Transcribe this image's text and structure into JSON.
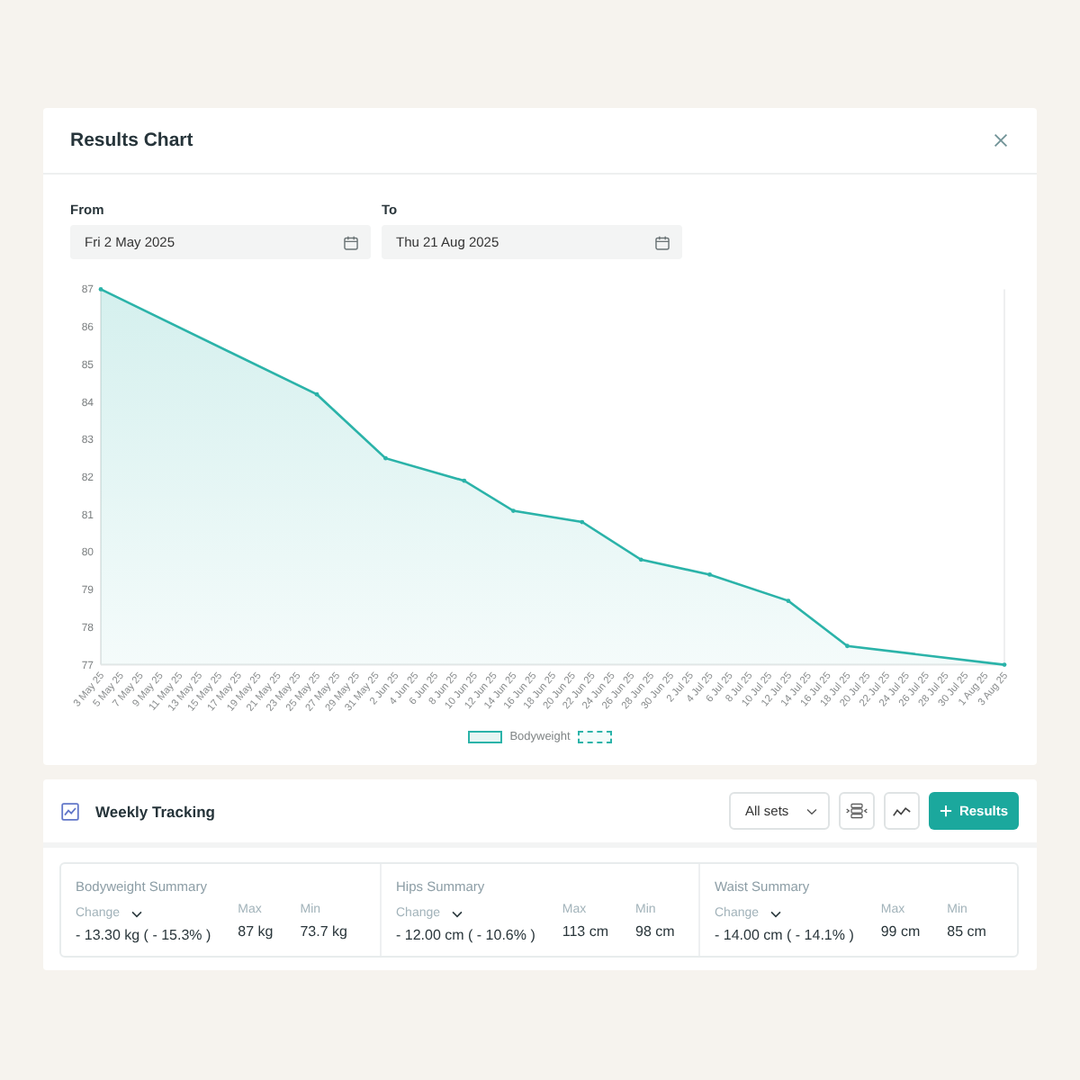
{
  "dialog": {
    "title": "Results Chart"
  },
  "date_range": {
    "from": {
      "label": "From",
      "value": "Fri 2 May 2025"
    },
    "to": {
      "label": "To",
      "value": "Thu 21 Aug 2025"
    }
  },
  "chart_data": {
    "type": "area",
    "ylim": [
      77,
      87
    ],
    "yticks": [
      77,
      78,
      79,
      80,
      81,
      82,
      83,
      84,
      85,
      86,
      87
    ],
    "categories": [
      "3 May 25",
      null,
      "5 May 25",
      null,
      "7 May 25",
      null,
      "9 May 25",
      null,
      "11 May 25",
      null,
      "13 May 25",
      null,
      "15 May 25",
      null,
      "17 May 25",
      null,
      "19 May 25",
      null,
      "21 May 25",
      null,
      "23 May 25",
      null,
      "25 May 25",
      null,
      "27 May 25",
      null,
      "29 May 25",
      null,
      "31 May 25",
      null,
      "2 Jun 25",
      null,
      "4 Jun 25",
      null,
      "6 Jun 25",
      null,
      "8 Jun 25",
      null,
      "10 Jun 25",
      null,
      "12 Jun 25",
      null,
      "14 Jun 25",
      null,
      "16 Jun 25",
      null,
      "18 Jun 25",
      null,
      "20 Jun 25",
      null,
      "22 Jun 25",
      null,
      "24 Jun 25",
      null,
      "26 Jun 25",
      null,
      "28 Jun 25",
      null,
      "30 Jun 25",
      null,
      "2 Jul 25",
      null,
      "4 Jul 25",
      null,
      "6 Jul 25",
      null,
      "8 Jul 25",
      null,
      "10 Jul 25",
      null,
      "12 Jul 25",
      null,
      "14 Jul 25",
      null,
      "16 Jul 25",
      null,
      "18 Jul 25",
      null,
      "20 Jul 25",
      null,
      "22 Jul 25",
      null,
      "24 Jul 25",
      null,
      "26 Jul 25",
      null,
      "28 Jul 25",
      null,
      "30 Jul 25",
      null,
      "1 Aug 25",
      null,
      "3 Aug 25"
    ],
    "series": [
      {
        "name": "Bodyweight",
        "color": "#2bb3a9",
        "values": [
          87,
          null,
          null,
          null,
          null,
          null,
          null,
          null,
          null,
          null,
          null,
          null,
          null,
          null,
          null,
          null,
          null,
          null,
          null,
          null,
          null,
          null,
          84.2,
          null,
          null,
          null,
          null,
          null,
          null,
          82.5,
          null,
          null,
          null,
          null,
          null,
          null,
          null,
          81.9,
          null,
          null,
          null,
          null,
          81.1,
          null,
          null,
          null,
          null,
          null,
          null,
          80.8,
          null,
          null,
          null,
          null,
          null,
          79.8,
          null,
          null,
          null,
          null,
          null,
          null,
          79.4,
          null,
          null,
          null,
          null,
          null,
          null,
          null,
          78.7,
          null,
          null,
          null,
          null,
          null,
          77.5,
          null,
          null,
          null,
          null,
          null,
          null,
          null,
          null,
          null,
          null,
          null,
          null,
          null,
          null,
          null,
          77
        ]
      }
    ]
  },
  "weekly_tracking": {
    "title": "Weekly Tracking",
    "set_filter": "All sets",
    "add_button": "Results",
    "summaries": [
      {
        "title": "Bodyweight Summary",
        "change_label": "Change",
        "change": "- 13.30 kg ( - 15.3% )",
        "max_label": "Max",
        "max": "87 kg",
        "min_label": "Min",
        "min": "73.7 kg"
      },
      {
        "title": "Hips Summary",
        "change_label": "Change",
        "change": "- 12.00 cm ( - 10.6% )",
        "max_label": "Max",
        "max": "113 cm",
        "min_label": "Min",
        "min": "98 cm"
      },
      {
        "title": "Waist Summary",
        "change_label": "Change",
        "change": "- 14.00 cm ( - 14.1% )",
        "max_label": "Max",
        "max": "99 cm",
        "min_label": "Min",
        "min": "85 cm"
      }
    ]
  }
}
